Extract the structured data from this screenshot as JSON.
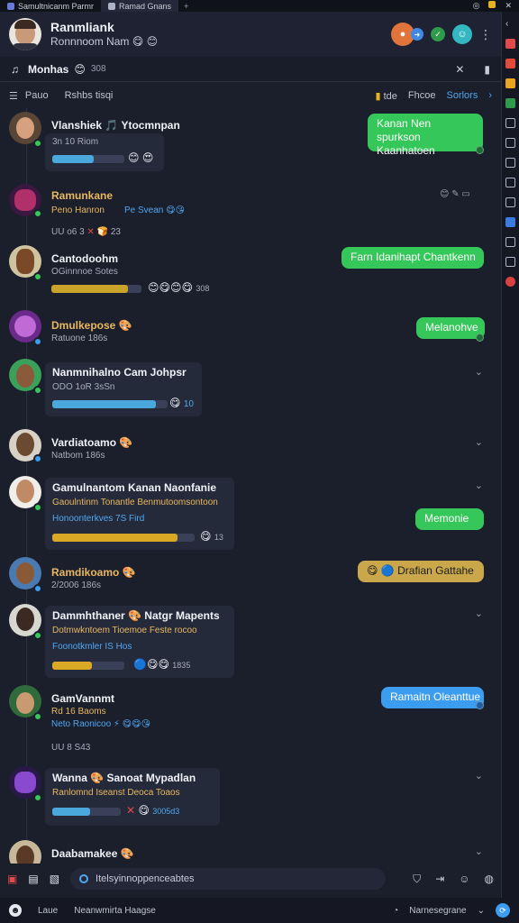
{
  "tabs": [
    {
      "label": "Samultnicanm Parmr"
    },
    {
      "label": "Ramad Gnans"
    }
  ],
  "header": {
    "title": "Ranmliank",
    "subtitle": "Ronnnoom Nam"
  },
  "tabrow": {
    "name": "Monhas",
    "count": "308"
  },
  "filter": {
    "left1": "Pauo",
    "left2": "Rshbs tisqi",
    "r1": "tde",
    "r2": "Fhcoe",
    "r3": "Sorlors"
  },
  "messages": [
    {
      "name": "Vlanshiek",
      "name2": "Ytocmnpan",
      "sub": "3n 10 Riom",
      "progress": 0.58
    },
    {
      "name": "Ramunkane",
      "sub": "Peno Hanron",
      "sub2": "Pe Svean",
      "meta": "UU o6 3"
    },
    {
      "name": "Cantodoohm",
      "sub": "OGinnnoe Sotes",
      "progress": 0.85,
      "count": "308"
    },
    {
      "name": "Dmulkepose",
      "sub": "Ratuone 186s"
    },
    {
      "name": "Nanmnihalno Cam Johpsr",
      "sub": "ODO 1oR 3sSn",
      "progress": 0.9
    },
    {
      "name": "Vardiatoamo",
      "sub": "Natbom 186s"
    },
    {
      "name": "Gamulnantom Kanan Naonfanie",
      "sub": "Gaoulntinm Tonantle Benmutoomsontoon",
      "sub2": "Honoonterkves 7S Fird",
      "progress": 0.88,
      "count": "13"
    },
    {
      "name": "Ramdikoamo",
      "sub": "2/2006 186s"
    },
    {
      "name": "Dammhthaner",
      "name2": "Natgr Mapents",
      "sub": "Dotmwkntoem Tioemoe Feste rocoo",
      "sub2": "Foonotkmler IS Hos",
      "progress": 0.55,
      "count": "1835"
    },
    {
      "name": "GamVannmt",
      "sub": "Rd 16 Baoms",
      "sub2": "Neto Raonicoo",
      "meta": "UU 8 S43"
    },
    {
      "name": "Wanna",
      "name2": "Sanoat Mypadlan",
      "sub": "Ranlomnd Iseanst Deoca Toaos",
      "progress": 0.55,
      "count": "3005d3"
    },
    {
      "name": "Daabamakee"
    }
  ],
  "replies": [
    {
      "text": "Kanan Nen spurkson\nKaanhatoen"
    },
    {
      "text": "Farn Idanihapt Chantkenn"
    },
    {
      "text": "Melanohve"
    },
    {
      "text": "Memonie"
    },
    {
      "text": "Drafian Gattahe"
    },
    {
      "text": "Ramaitn Oleanttue"
    }
  ],
  "composer": {
    "placeholder": "Itelsyinnoppenceabtes"
  },
  "statusbar": {
    "left1": "Laue",
    "left2": "Neanwmirta Haagse",
    "right": "Narnesegrane"
  },
  "colors": {
    "bg": "#1b1e2b",
    "green": "#35c759",
    "blue": "#3b9cf0",
    "progress_blue": "#4aa8dd",
    "progress_gold": "#d9a825"
  }
}
